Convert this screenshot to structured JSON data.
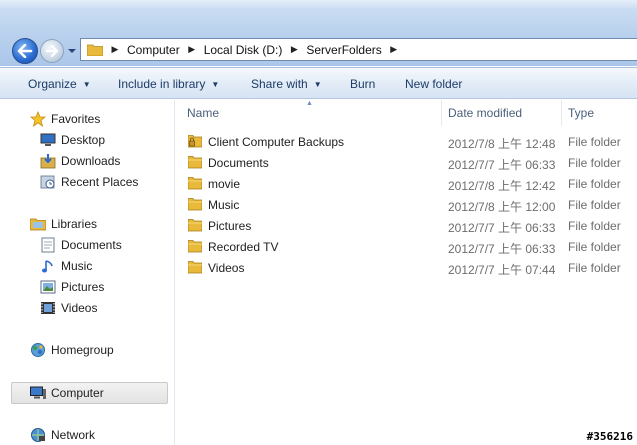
{
  "address": {
    "crumbs": [
      "Computer",
      "Local Disk (D:)",
      "ServerFolders"
    ]
  },
  "toolbar": {
    "organize": "Organize",
    "include_in_library": "Include in library",
    "share_with": "Share with",
    "burn": "Burn",
    "new_folder": "New folder"
  },
  "navigation": {
    "favorites": {
      "label": "Favorites",
      "icon": "star-icon"
    },
    "favorites_items": [
      {
        "label": "Desktop",
        "icon": "desktop-icon"
      },
      {
        "label": "Downloads",
        "icon": "downloads-icon"
      },
      {
        "label": "Recent Places",
        "icon": "recent-places-icon"
      }
    ],
    "libraries": {
      "label": "Libraries",
      "icon": "libraries-icon"
    },
    "libraries_items": [
      {
        "label": "Documents",
        "icon": "documents-icon"
      },
      {
        "label": "Music",
        "icon": "music-icon"
      },
      {
        "label": "Pictures",
        "icon": "pictures-icon"
      },
      {
        "label": "Videos",
        "icon": "videos-icon"
      }
    ],
    "homegroup": {
      "label": "Homegroup",
      "icon": "homegroup-icon"
    },
    "computer": {
      "label": "Computer",
      "icon": "computer-icon",
      "selected": true
    },
    "network": {
      "label": "Network",
      "icon": "network-icon"
    }
  },
  "columns": {
    "name": "Name",
    "date_modified": "Date modified",
    "type": "Type"
  },
  "files": [
    {
      "name": "Client Computer Backups",
      "date": "2012/7/8 上午 12:48",
      "type": "File folder",
      "locked": true
    },
    {
      "name": "Documents",
      "date": "2012/7/7 上午 06:33",
      "type": "File folder",
      "locked": false
    },
    {
      "name": "movie",
      "date": "2012/7/8 上午 12:42",
      "type": "File folder",
      "locked": false
    },
    {
      "name": "Music",
      "date": "2012/7/8 上午 12:00",
      "type": "File folder",
      "locked": false
    },
    {
      "name": "Pictures",
      "date": "2012/7/7 上午 06:33",
      "type": "File folder",
      "locked": false
    },
    {
      "name": "Recorded TV",
      "date": "2012/7/7 上午 06:33",
      "type": "File folder",
      "locked": false
    },
    {
      "name": "Videos",
      "date": "2012/7/7 上午 07:44",
      "type": "File folder",
      "locked": false
    }
  ],
  "watermark": "#356216",
  "colors": {
    "folder": "#e8b93a",
    "selection": "#e6e6e6",
    "link_text": "#1c3c66"
  }
}
